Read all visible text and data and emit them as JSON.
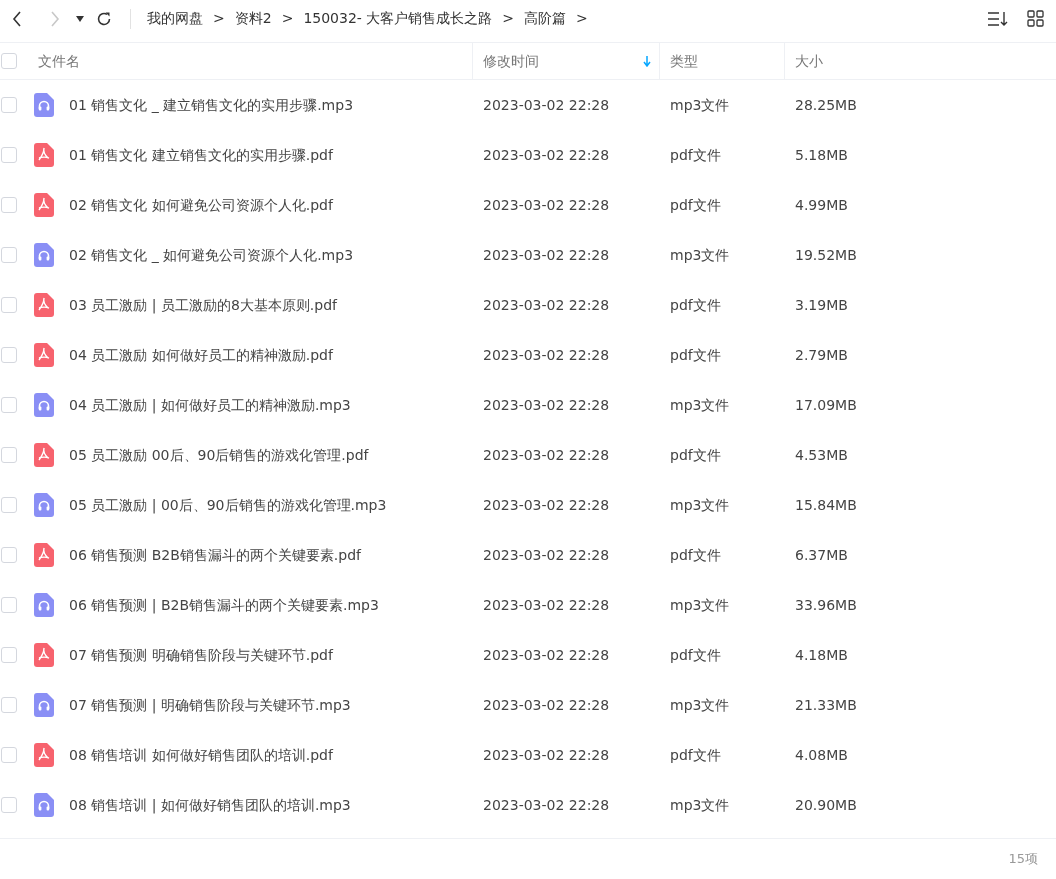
{
  "nav": {
    "back_disabled": false,
    "forward_disabled": true
  },
  "breadcrumb": [
    "我的网盘",
    "资料2",
    "150032- 大客户销售成长之路",
    "高阶篇"
  ],
  "separator": ">",
  "columns": [
    {
      "label": "文件名",
      "sorted": false
    },
    {
      "label": "修改时间",
      "sorted": true
    },
    {
      "label": "类型",
      "sorted": false
    },
    {
      "label": "大小",
      "sorted": false
    }
  ],
  "rows": [
    {
      "kind": "mp3",
      "name": "01 销售文化 _ 建立销售文化的实用步骤.mp3",
      "modified": "2023-03-02 22:28",
      "type": "mp3文件",
      "size": "28.25MB",
      "checked": false
    },
    {
      "kind": "pdf",
      "name": "01 销售文化 建立销售文化的实用步骤.pdf",
      "modified": "2023-03-02 22:28",
      "type": "pdf文件",
      "size": "5.18MB",
      "checked": false
    },
    {
      "kind": "pdf",
      "name": "02 销售文化  如何避免公司资源个人化.pdf",
      "modified": "2023-03-02 22:28",
      "type": "pdf文件",
      "size": "4.99MB",
      "checked": false
    },
    {
      "kind": "mp3",
      "name": "02 销售文化 _ 如何避免公司资源个人化.mp3",
      "modified": "2023-03-02 22:28",
      "type": "mp3文件",
      "size": "19.52MB",
      "checked": false
    },
    {
      "kind": "pdf",
      "name": "03 员工激励 | 员工激励的8大基本原则.pdf",
      "modified": "2023-03-02 22:28",
      "type": "pdf文件",
      "size": "3.19MB",
      "checked": false
    },
    {
      "kind": "pdf",
      "name": "04 员工激励 如何做好员工的精神激励.pdf",
      "modified": "2023-03-02 22:28",
      "type": "pdf文件",
      "size": "2.79MB",
      "checked": false
    },
    {
      "kind": "mp3",
      "name": "04 员工激励 | 如何做好员工的精神激励.mp3",
      "modified": "2023-03-02 22:28",
      "type": "mp3文件",
      "size": "17.09MB",
      "checked": false
    },
    {
      "kind": "pdf",
      "name": "05 员工激励 00后、90后销售的游戏化管理.pdf",
      "modified": "2023-03-02 22:28",
      "type": "pdf文件",
      "size": "4.53MB",
      "checked": false
    },
    {
      "kind": "mp3",
      "name": "05 员工激励 | 00后、90后销售的游戏化管理.mp3",
      "modified": "2023-03-02 22:28",
      "type": "mp3文件",
      "size": "15.84MB",
      "checked": false
    },
    {
      "kind": "pdf",
      "name": "06 销售预测 B2B销售漏斗的两个关键要素.pdf",
      "modified": "2023-03-02 22:28",
      "type": "pdf文件",
      "size": "6.37MB",
      "checked": false
    },
    {
      "kind": "mp3",
      "name": "06 销售预测 | B2B销售漏斗的两个关键要素.mp3",
      "modified": "2023-03-02 22:28",
      "type": "mp3文件",
      "size": "33.96MB",
      "checked": false
    },
    {
      "kind": "pdf",
      "name": "07 销售预测 明确销售阶段与关键环节.pdf",
      "modified": "2023-03-02 22:28",
      "type": "pdf文件",
      "size": "4.18MB",
      "checked": false
    },
    {
      "kind": "mp3",
      "name": "07 销售预测 | 明确销售阶段与关键环节.mp3",
      "modified": "2023-03-02 22:28",
      "type": "mp3文件",
      "size": "21.33MB",
      "checked": false
    },
    {
      "kind": "pdf",
      "name": "08 销售培训 如何做好销售团队的培训.pdf",
      "modified": "2023-03-02 22:28",
      "type": "pdf文件",
      "size": "4.08MB",
      "checked": false
    },
    {
      "kind": "mp3",
      "name": "08 销售培训 | 如何做好销售团队的培训.mp3",
      "modified": "2023-03-02 22:28",
      "type": "mp3文件",
      "size": "20.90MB",
      "checked": false
    }
  ],
  "select_all": {
    "checked": false
  },
  "status": "15项"
}
